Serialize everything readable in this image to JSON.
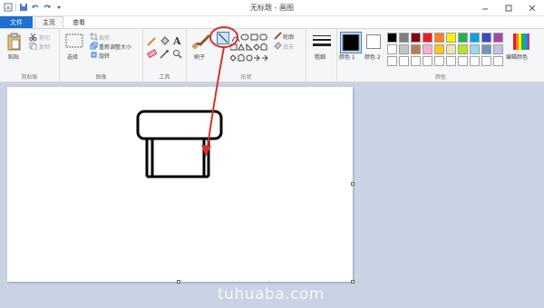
{
  "window": {
    "title": "无标题 - 画图",
    "controls": [
      "minimize",
      "maximize",
      "close"
    ]
  },
  "tabs": {
    "file": "文件",
    "home": "主页",
    "view": "查看"
  },
  "ribbon": {
    "clipboard": {
      "label": "剪贴板",
      "paste": "粘贴",
      "cut": "剪切",
      "copy": "复制"
    },
    "image": {
      "label": "图像",
      "select": "选择",
      "crop": "裁剪",
      "resize": "重新调整大小",
      "rotate": "旋转"
    },
    "tools": {
      "label": "工具"
    },
    "shapes": {
      "label": "形状",
      "brush": "刷子",
      "outline": "轮廓",
      "fill": "填充"
    },
    "size": {
      "label": "粗细"
    },
    "colors": {
      "label": "颜色",
      "color1": "颜色 1",
      "color2": "颜色 2",
      "edit": "编辑颜色"
    }
  },
  "palette": [
    "#000000",
    "#7f7f7f",
    "#880015",
    "#ed1c24",
    "#ff7f27",
    "#fff200",
    "#22b14c",
    "#00a2e8",
    "#3f48cc",
    "#a349a4",
    "#ffffff",
    "#c3c3c3",
    "#b97a57",
    "#ffaec9",
    "#ffc90e",
    "#efe4b0",
    "#b5e61d",
    "#99d9ea",
    "#7092be",
    "#c8bfe7",
    "#ffffff",
    "#ffffff",
    "#ffffff",
    "#ffffff",
    "#ffffff",
    "#ffffff",
    "#ffffff",
    "#ffffff",
    "#ffffff",
    "#ffffff"
  ],
  "annotation_color": "#d9302c",
  "accent": "#1e6fd0",
  "watermark": "tuhuaba.com"
}
